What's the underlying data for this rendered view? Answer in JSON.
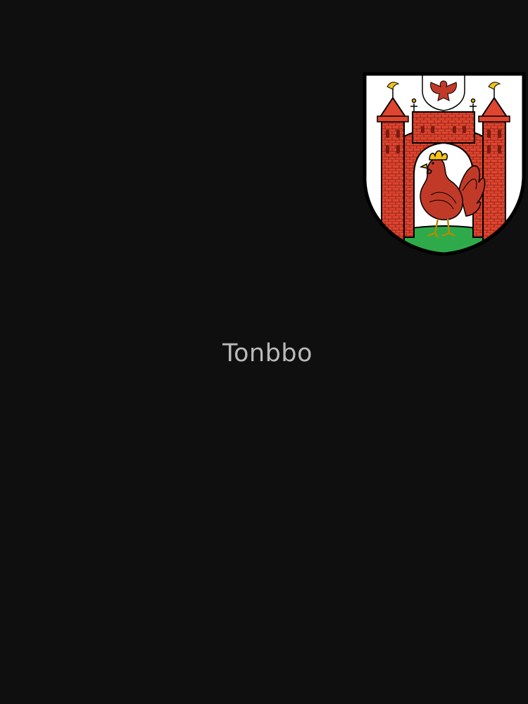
{
  "artwork": {
    "type": "coat-of-arms",
    "charges": [
      "brick-gate-with-two-towers",
      "red-rooster",
      "brandenburg-eagle-inescutcheon",
      "green-mound"
    ],
    "colors": {
      "background": "#0f0f0f",
      "shield_field": "#ffffff",
      "brick": "#e0452f",
      "rooster": "#c13a28",
      "comb": "#f3c21b",
      "mound": "#2eaa4a",
      "outline": "#000000"
    }
  },
  "watermark": {
    "text": "Tonbbo"
  }
}
